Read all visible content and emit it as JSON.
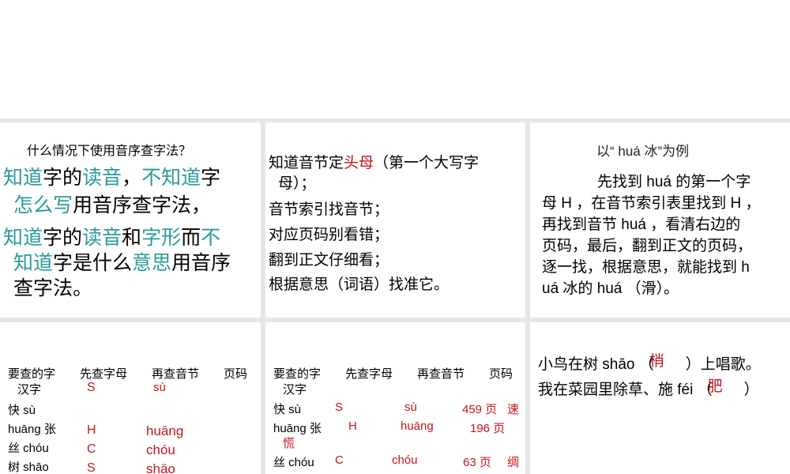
{
  "panel1": {
    "question": "什么情况下使用音序查字法？",
    "p1": [
      {
        "t": "知道",
        "c": 1
      },
      {
        "t": "字的",
        "c": 0
      },
      {
        "t": "读音",
        "c": 1
      },
      {
        "t": "，",
        "c": 0
      },
      {
        "t": "不知道",
        "c": 1
      },
      {
        "t": "字",
        "c": 0
      }
    ],
    "p1b": [
      {
        "t": "怎么写",
        "c": 1
      },
      {
        "t": "用音序查字法，",
        "c": 0
      }
    ],
    "p2": [
      {
        "t": "知道",
        "c": 1
      },
      {
        "t": "字的",
        "c": 0
      },
      {
        "t": "读音",
        "c": 1
      },
      {
        "t": "和",
        "c": 0
      },
      {
        "t": "字形",
        "c": 1
      },
      {
        "t": "而",
        "c": 0
      },
      {
        "t": "不",
        "c": 1
      }
    ],
    "p2b": [
      {
        "t": "知道",
        "c": 1
      },
      {
        "t": "字是什么",
        "c": 0
      },
      {
        "t": "意思",
        "c": 1
      },
      {
        "t": "用音序",
        "c": 0
      }
    ],
    "p2c": "查字法。"
  },
  "panel2": {
    "l1a": "知道音节定",
    "l1b": "头母",
    "l1c": "（第一个大写字",
    "l1d": "母）；",
    "l2": "音节索引找音节；",
    "l3": "对应页码别看错；",
    "l4": "翻到正文仔细看；",
    "l5": "根据意思（词语）找准它。"
  },
  "panel3": {
    "title": "以“ huá 冰”为例",
    "lines": [
      "先找到 huá 的第一个字",
      "母 H ，在音节索引表里找到 H ，",
      "再找到音节 huá ，看清右边的",
      "页码，最后，翻到正文的页码，",
      "逐一找，根据意思，就能找到 h",
      "uá 冰的 huá （滑）。"
    ]
  },
  "table_headers": [
    "要查的字",
    "先查字母",
    "再查音节",
    "页码",
    "汉字"
  ],
  "panel4": {
    "rows": [
      "快 sù",
      "huāng 张",
      "丝 chóu",
      "树 shāo"
    ],
    "letters": [
      "S",
      "H",
      "C",
      "S"
    ],
    "syllables": [
      "sù",
      "huāng",
      "chóu",
      "shāo"
    ]
  },
  "panel5": {
    "rows": [
      {
        "w": "快 sù",
        "l": "S",
        "s": "sù",
        "p": "459 页",
        "a": "速"
      },
      {
        "w": "huāng 张",
        "l": "H",
        "s": "huāng",
        "p": "196 页",
        "a": "慌"
      },
      {
        "w": "丝 chóu",
        "l": "C",
        "s": "chóu",
        "p": "63 页",
        "a": "绸"
      }
    ]
  },
  "panel6": {
    "s1a": "小鸟在树 shāo （",
    "s1ans": "梢",
    "s1b": "）上唱歌。",
    "s2a": "我在菜园里除草、施 féi （",
    "s2ans": "肥",
    "s2b": "）"
  }
}
